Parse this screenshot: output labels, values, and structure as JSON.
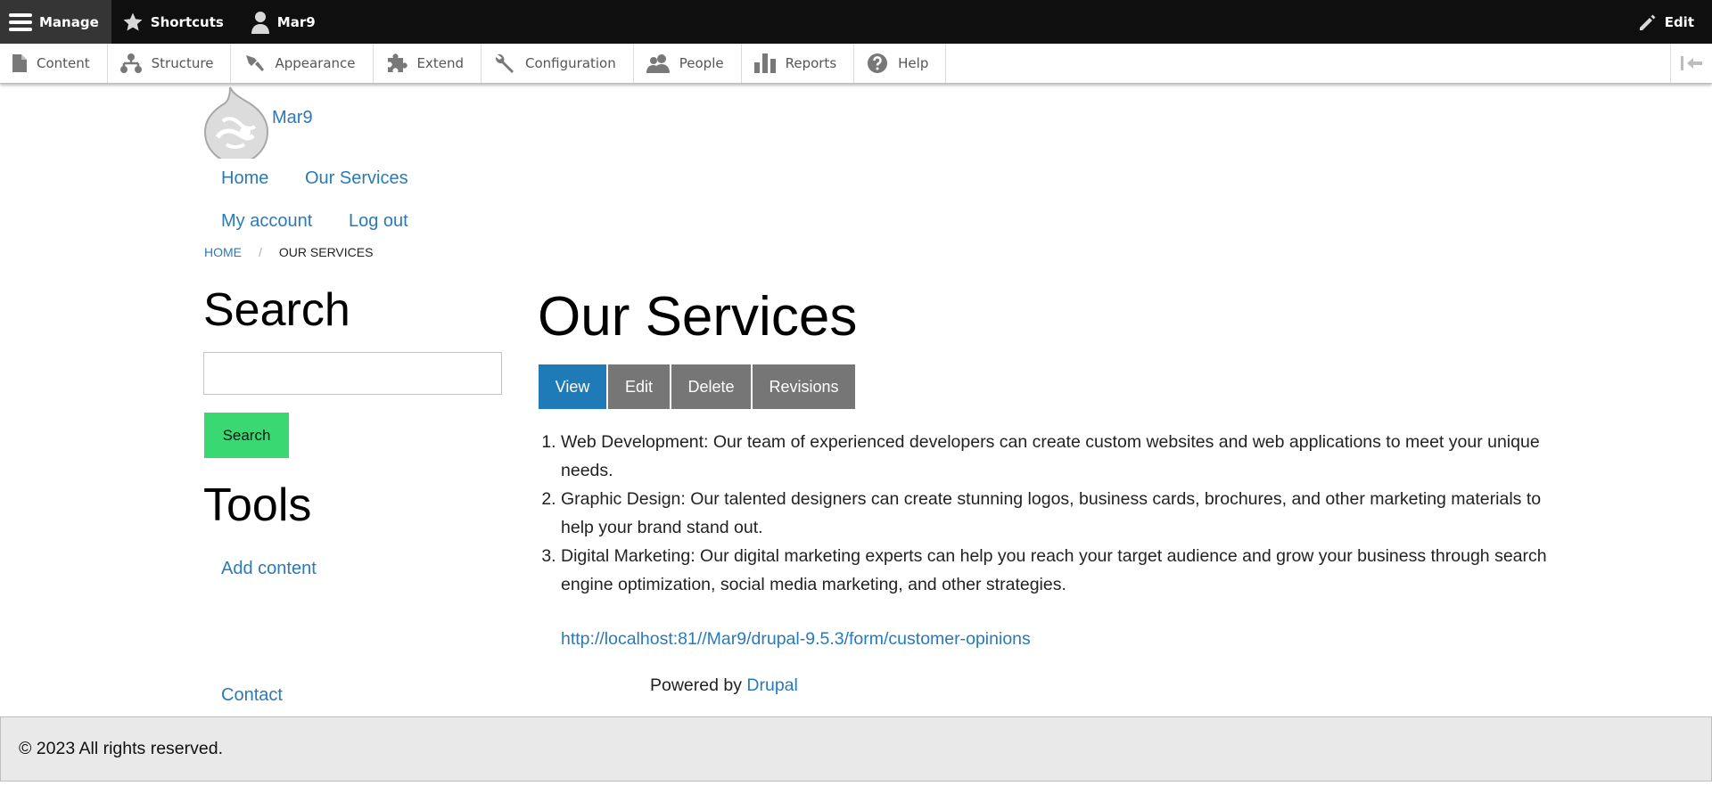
{
  "toolbar": {
    "manage": "Manage",
    "shortcuts": "Shortcuts",
    "user": "Mar9",
    "edit": "Edit"
  },
  "tray": {
    "items": [
      "Content",
      "Structure",
      "Appearance",
      "Extend",
      "Configuration",
      "People",
      "Reports",
      "Help"
    ]
  },
  "site": {
    "name": "Mar9"
  },
  "nav": {
    "main": [
      "Home",
      "Our Services"
    ],
    "account": [
      "My account",
      "Log out"
    ]
  },
  "breadcrumb": {
    "home": "HOME",
    "separator": "/",
    "current": "OUR SERVICES"
  },
  "sidebar": {
    "search_heading": "Search",
    "search_value": "",
    "search_button": "Search",
    "tools_heading": "Tools",
    "add_content": "Add content",
    "contact": "Contact"
  },
  "main": {
    "title": "Our Services",
    "tabs": [
      "View",
      "Edit",
      "Delete",
      "Revisions"
    ],
    "active_tab": "View",
    "services": [
      "Web Development: Our team of experienced developers can create custom websites and web applications to meet your unique needs.",
      "Graphic Design: Our talented designers can create stunning logos, business cards, brochures, and other marketing materials to help your brand stand out.",
      "Digital Marketing: Our digital marketing experts can help you reach your target audience and grow your business through search engine optimization, social media marketing, and other strategies."
    ],
    "form_link": "http://localhost:81//Mar9/drupal-9.5.3/form/customer-opinions",
    "powered_by": "Powered by",
    "drupal": "Drupal"
  },
  "footer": {
    "copyright": "© 2023 All rights reserved."
  },
  "colors": {
    "link": "#2a7ab8",
    "active_tab": "#1f7ab8",
    "tab": "#767676",
    "search_button": "#3ad873",
    "toolbar": "#0f0f0f"
  }
}
